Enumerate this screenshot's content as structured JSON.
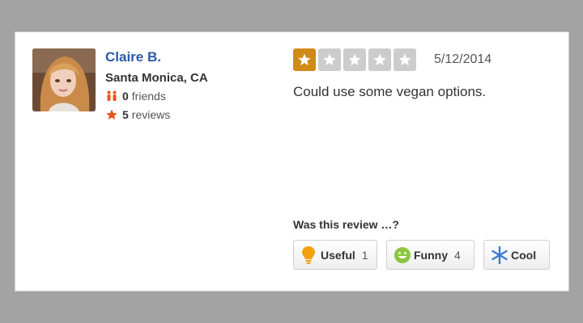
{
  "user": {
    "name": "Claire B.",
    "location": "Santa Monica, CA",
    "friends_count": "0",
    "friends_label": "friends",
    "reviews_count": "5",
    "reviews_label": "reviews",
    "avatar_icon": "profile-photo"
  },
  "review": {
    "rating": 1,
    "max_rating": 5,
    "date": "5/12/2014",
    "text": "Could use some vegan options."
  },
  "feedback": {
    "prompt": "Was this review …?",
    "buttons": [
      {
        "label": "Useful",
        "count": "1",
        "icon": "lightbulb-icon"
      },
      {
        "label": "Funny",
        "count": "4",
        "icon": "smiley-icon"
      },
      {
        "label": "Cool",
        "count": "",
        "icon": "snowflake-icon"
      }
    ]
  },
  "colors": {
    "background": "#a3a3a3",
    "name_link": "#2b5aa6",
    "star_filled": "#d08a16",
    "star_empty": "#cccccc",
    "stat_icon": "#e8561c"
  }
}
